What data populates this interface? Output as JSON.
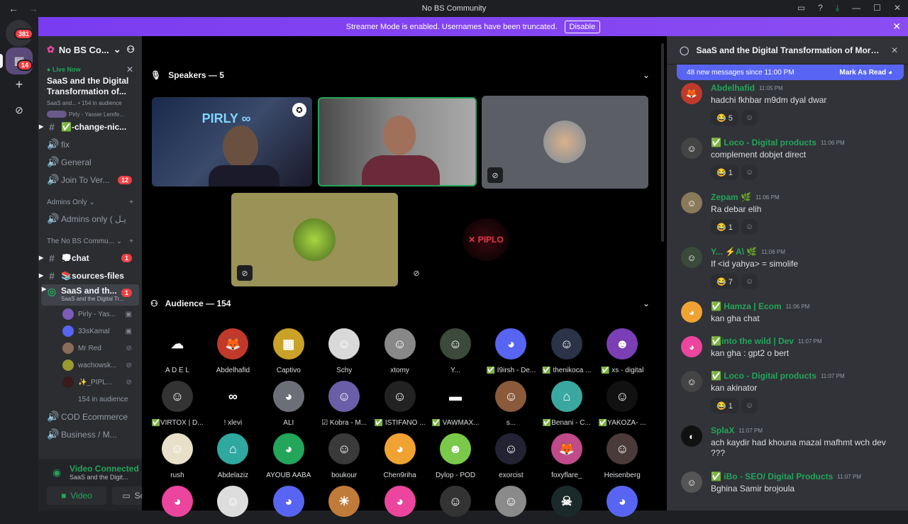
{
  "window": {
    "title": "No BS Community",
    "back": "←",
    "forward": "→"
  },
  "banner": {
    "text": "Streamer Mode is enabled. Usernames have been truncated.",
    "button": "Disable"
  },
  "guilds": {
    "home_badge": "381",
    "server_badge": "14",
    "add_icon": "+",
    "discover_icon": "⊘"
  },
  "server": {
    "name": "No BS Co..."
  },
  "live": {
    "label": "Live Now",
    "title": "SaaS and the Digital Transformation of...",
    "sub": "SaaS and... • 154 in audience",
    "speakers": "Pirly - Yasser Lemfe..."
  },
  "channels_top": [
    {
      "sym": "#",
      "label": "✅-change-nic...",
      "unread": true,
      "count": ""
    },
    {
      "sym": "🔊",
      "label": "fix",
      "unread": false,
      "count": ""
    },
    {
      "sym": "🔊",
      "label": "General",
      "unread": false,
      "count": ""
    },
    {
      "sym": "🔊",
      "label": "Join To Ver...",
      "unread": false,
      "count": "12"
    }
  ],
  "cat_admins": {
    "label": "Admins Only ⌄",
    "plus": "+"
  },
  "channels_admin": [
    {
      "sym": "🔊",
      "label": "Admins only ( يـل",
      "unread": false,
      "count": ""
    }
  ],
  "cat_nobs": {
    "label": "The No BS Commu... ⌄",
    "plus": "+"
  },
  "channels_nobs": [
    {
      "sym": "#",
      "label": "💭chat",
      "unread": true,
      "count": "1"
    },
    {
      "sym": "#",
      "label": "📚sources-files",
      "unread": true,
      "count": ""
    }
  ],
  "stage_channel": {
    "label": "SaaS and th...",
    "sub": "SaaS and the Digital Tr...",
    "count": "1"
  },
  "voice_users": [
    {
      "name": "Pirly - Yas...",
      "status": "▣",
      "color": "#7a5cb8"
    },
    {
      "name": "33sKamal",
      "status": "▣",
      "color": "#5865f2"
    },
    {
      "name": "Mr Red",
      "status": "⊘",
      "color": "#8a6c5a"
    },
    {
      "name": "wachowsk...",
      "status": "⊘",
      "color": "#9a9a30"
    },
    {
      "name": "✨_PIPL...",
      "status": "⊘",
      "color": "#3a1a1a"
    },
    {
      "name": "154 in audience",
      "status": "",
      "color": "transparent"
    }
  ],
  "channels_bottom": [
    {
      "sym": "🔊",
      "label": "COD Ecommerce",
      "unread": false,
      "count": ""
    },
    {
      "sym": "🔊",
      "label": "Business / M...",
      "unread": false,
      "count": ""
    }
  ],
  "voice_connected": {
    "title": "Video Connected",
    "sub": "SaaS and the Digit...",
    "video": "Video",
    "screen": "Screen"
  },
  "stage": {
    "speakers_label": "Speakers — 5",
    "audience_label": "Audience — 154",
    "audience": [
      {
        "name": "A D E L",
        "color": "#000000",
        "glyph": "☁"
      },
      {
        "name": "Abdelhafid",
        "color": "#c0392b",
        "glyph": "🦊"
      },
      {
        "name": "Captivo",
        "color": "#c9a227",
        "glyph": "▦"
      },
      {
        "name": "Schy",
        "color": "#d9d9d9",
        "glyph": "☺"
      },
      {
        "name": "xtomy",
        "color": "#888888",
        "glyph": "☺"
      },
      {
        "name": "Y...",
        "color": "#3b4a3a",
        "glyph": "☺"
      },
      {
        "name": "✅ I9irsh - De...",
        "color": "#5865f2",
        "glyph": "◕"
      },
      {
        "name": "✅ thenikoca ...",
        "color": "#2a3348",
        "glyph": "☺"
      },
      {
        "name": "✅ xs - digital",
        "color": "#7b3fb5",
        "glyph": "☻"
      },
      {
        "name": "✅VIRTOX | D...",
        "color": "#333333",
        "glyph": "☺"
      },
      {
        "name": "! xlevi",
        "color": "#000000",
        "glyph": "∞"
      },
      {
        "name": "ALI",
        "color": "#6d6f78",
        "glyph": "◕"
      },
      {
        "name": "☑ Kobra - M...",
        "color": "#6b5ea8",
        "glyph": "☺"
      },
      {
        "name": "✅ ISTIFANO ...",
        "color": "#222222",
        "glyph": "☺"
      },
      {
        "name": "✅ VAWMAX...",
        "color": "#000000",
        "glyph": "▬"
      },
      {
        "name": "s...",
        "color": "#8a5a3a",
        "glyph": "☺"
      },
      {
        "name": "✅Benani - C...",
        "color": "#3aa8a0",
        "glyph": "⌂"
      },
      {
        "name": "✅YAKOZA- ...",
        "color": "#111111",
        "glyph": "☺"
      },
      {
        "name": "rush",
        "color": "#e8e0c8",
        "glyph": "☺"
      },
      {
        "name": "Abdelaziz",
        "color": "#2fa8a0",
        "glyph": "⌂"
      },
      {
        "name": "AYOUB AABA",
        "color": "#23a55a",
        "glyph": "◕"
      },
      {
        "name": "boukour",
        "color": "#3a3a3a",
        "glyph": "☺"
      },
      {
        "name": "Chen9riha",
        "color": "#f0a232",
        "glyph": "◕"
      },
      {
        "name": "Dylop - POD",
        "color": "#7ac94a",
        "glyph": "☻"
      },
      {
        "name": "exorcist",
        "color": "#222233",
        "glyph": "☺"
      },
      {
        "name": "foxyflare_",
        "color": "#c04a8a",
        "glyph": "🦊"
      },
      {
        "name": "Heisenberg",
        "color": "#4a3a3a",
        "glyph": "☺"
      },
      {
        "name": "",
        "color": "#eb459e",
        "glyph": "◕"
      },
      {
        "name": "",
        "color": "#dddddd",
        "glyph": "☺"
      },
      {
        "name": "",
        "color": "#5865f2",
        "glyph": "◕"
      },
      {
        "name": "",
        "color": "#c07a3a",
        "glyph": "☀"
      },
      {
        "name": "",
        "color": "#eb459e",
        "glyph": "◕"
      },
      {
        "name": "",
        "color": "#333333",
        "glyph": "☺"
      },
      {
        "name": "",
        "color": "#8a8a8a",
        "glyph": "☺"
      },
      {
        "name": "",
        "color": "#1a2a2a",
        "glyph": "☠"
      },
      {
        "name": "",
        "color": "#5865f2",
        "glyph": "◕"
      }
    ]
  },
  "chat": {
    "title": "SaaS and the Digital Transformation of Moroccan In",
    "new_messages": "48 new messages since 11:00 PM",
    "mark_read": "Mark As Read",
    "messages": [
      {
        "name": "Abdelhafid",
        "time": "11:05 PM",
        "text": "hadchi fkhbar m9dm dyal dwar",
        "react": "😂 5",
        "color": "#c0392b",
        "glyph": "🦊"
      },
      {
        "name": "✅ Loco - Digital products",
        "time": "11:06 PM",
        "text": "complement dobjet direct",
        "react": "😂 1",
        "color": "#444444",
        "glyph": "☺"
      },
      {
        "name": "Zepam 🌿",
        "time": "11:06 PM",
        "text": "Ra debar elih",
        "react": "😂 1",
        "color": "#8a7a5a",
        "glyph": "☺"
      },
      {
        "name": "Y... ⚡A\\ 🌿",
        "time": "11:06 PM",
        "text": "If <id yahya> = simolife",
        "react": "😂 7",
        "color": "#3b4a3a",
        "glyph": "☺"
      },
      {
        "name": "✅ Hamza | Ecom",
        "time": "11:06 PM",
        "text": "kan gha chat",
        "react": "",
        "color": "#f0a232",
        "glyph": "◕"
      },
      {
        "name": "✅into the wild | Dev",
        "time": "11:07 PM",
        "text": "kan gha : gpt2 o bert",
        "react": "",
        "color": "#eb459e",
        "glyph": "◕"
      },
      {
        "name": "✅ Loco - Digital products",
        "time": "11:07 PM",
        "text": "kan akinator",
        "react": "😂 1",
        "color": "#444444",
        "glyph": "☺"
      },
      {
        "name": "SplaX",
        "time": "11:07 PM",
        "text": "ach kaydir had khouna mazal mafhmt wch dev ???",
        "react": "",
        "color": "#111111",
        "glyph": "◐"
      },
      {
        "name": "✅ iBo - SEO/ Digital Products",
        "time": "11:07 PM",
        "text": "Bghina Samir brojoula",
        "react": "",
        "color": "#555555",
        "glyph": "☺"
      }
    ]
  }
}
